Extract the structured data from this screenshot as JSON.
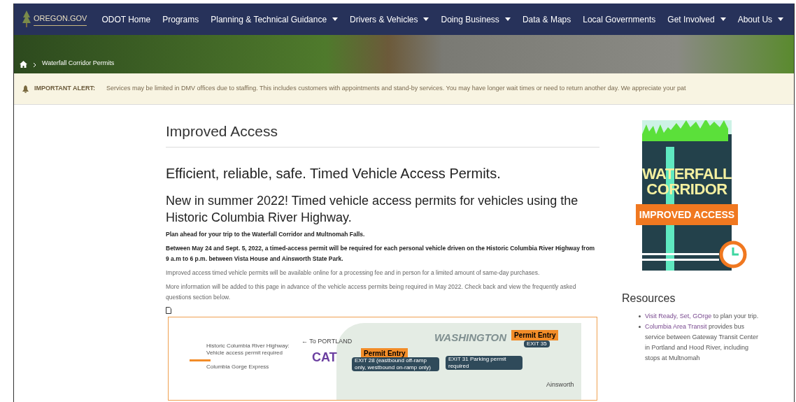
{
  "site": {
    "logo": "OREGON.GOV"
  },
  "nav": [
    {
      "label": "ODOT Home",
      "dropdown": false
    },
    {
      "label": "Programs",
      "dropdown": false
    },
    {
      "label": "Planning & Technical Guidance",
      "dropdown": true
    },
    {
      "label": "Drivers & Vehicles",
      "dropdown": true
    },
    {
      "label": "Doing Business",
      "dropdown": true
    },
    {
      "label": "Data & Maps",
      "dropdown": false
    },
    {
      "label": "Local Governments",
      "dropdown": false
    },
    {
      "label": "Get Involved",
      "dropdown": true
    },
    {
      "label": "About Us",
      "dropdown": true
    }
  ],
  "breadcrumb": [
    "Waterfall Corridor Permits"
  ],
  "alert": {
    "label": "IMPORTANT ALERT:",
    "text": "Services may be limited in DMV offices due to staffing.  This includes customers with appointments and stand-by services.  You may have longer wait times or need to return another day.  We appreciate your pat"
  },
  "page_title": "Improved Access",
  "headline": "Efficient, reliable, safe. Timed Vehicle Access Permits.",
  "subheadline": "New in summer 2022! Timed vehicle access permits for vehicles using the Historic Columbia River Highway.",
  "paragraphs": [
    {
      "text": "Plan ahead for your trip to the Waterfall Corridor and Multnomah Falls.",
      "bold": true
    },
    {
      "text": "Between May 24 and Sept. 5, 2022, a timed-access permit will be required for each personal vehicle driven on the Historic Columbia River Highway from 9 a.m to 6 p.m. between Vista House and Ainsworth State Park.",
      "bold": true
    },
    {
      "text": "Improved access timed vehicle permits will be available online for a processing fee and in person for a limited amount of same-day purchases.",
      "bold": false
    },
    {
      "text": "More information will be added to this page in advance of the vehicle access permits being required in May 2022. Check back and view the frequently asked questions section below.",
      "bold": false
    }
  ],
  "map": {
    "labels": [
      {
        "kind": "legend",
        "text": "Historic Columbia River Highway: Vehicle access permit required"
      },
      {
        "kind": "legend",
        "text": "Columbia Gorge Express"
      },
      {
        "kind": "direction",
        "text": "← To PORTLAND"
      },
      {
        "kind": "cat",
        "text": "CAT"
      },
      {
        "kind": "permit",
        "text": "Permit Entry"
      },
      {
        "kind": "exit",
        "text": "EXIT 28 (eastbound off-ramp only, westbound on-ramp only)"
      },
      {
        "kind": "region",
        "text": "WASHINGTON"
      },
      {
        "kind": "permit",
        "text": "Permit Entry"
      },
      {
        "kind": "exit",
        "text": "EXIT 35"
      },
      {
        "kind": "exit",
        "text": "EXIT 31 Parking permit required"
      },
      {
        "kind": "place",
        "text": "Ainsworth"
      }
    ]
  },
  "logo_graphic": {
    "line1": "WATERFALL",
    "line2": "CORRIDOR",
    "banner": "IMPROVED ACCESS"
  },
  "resources": {
    "title": "Resources",
    "items": [
      {
        "link": "Visit Ready, Set, GOrge",
        "text": " to plan your trip."
      },
      {
        "link": "Columbia Area Transit",
        "text": " provides bus service between Gateway Transit Center in Portland and Hood River, including stops at Multnomah"
      }
    ]
  }
}
